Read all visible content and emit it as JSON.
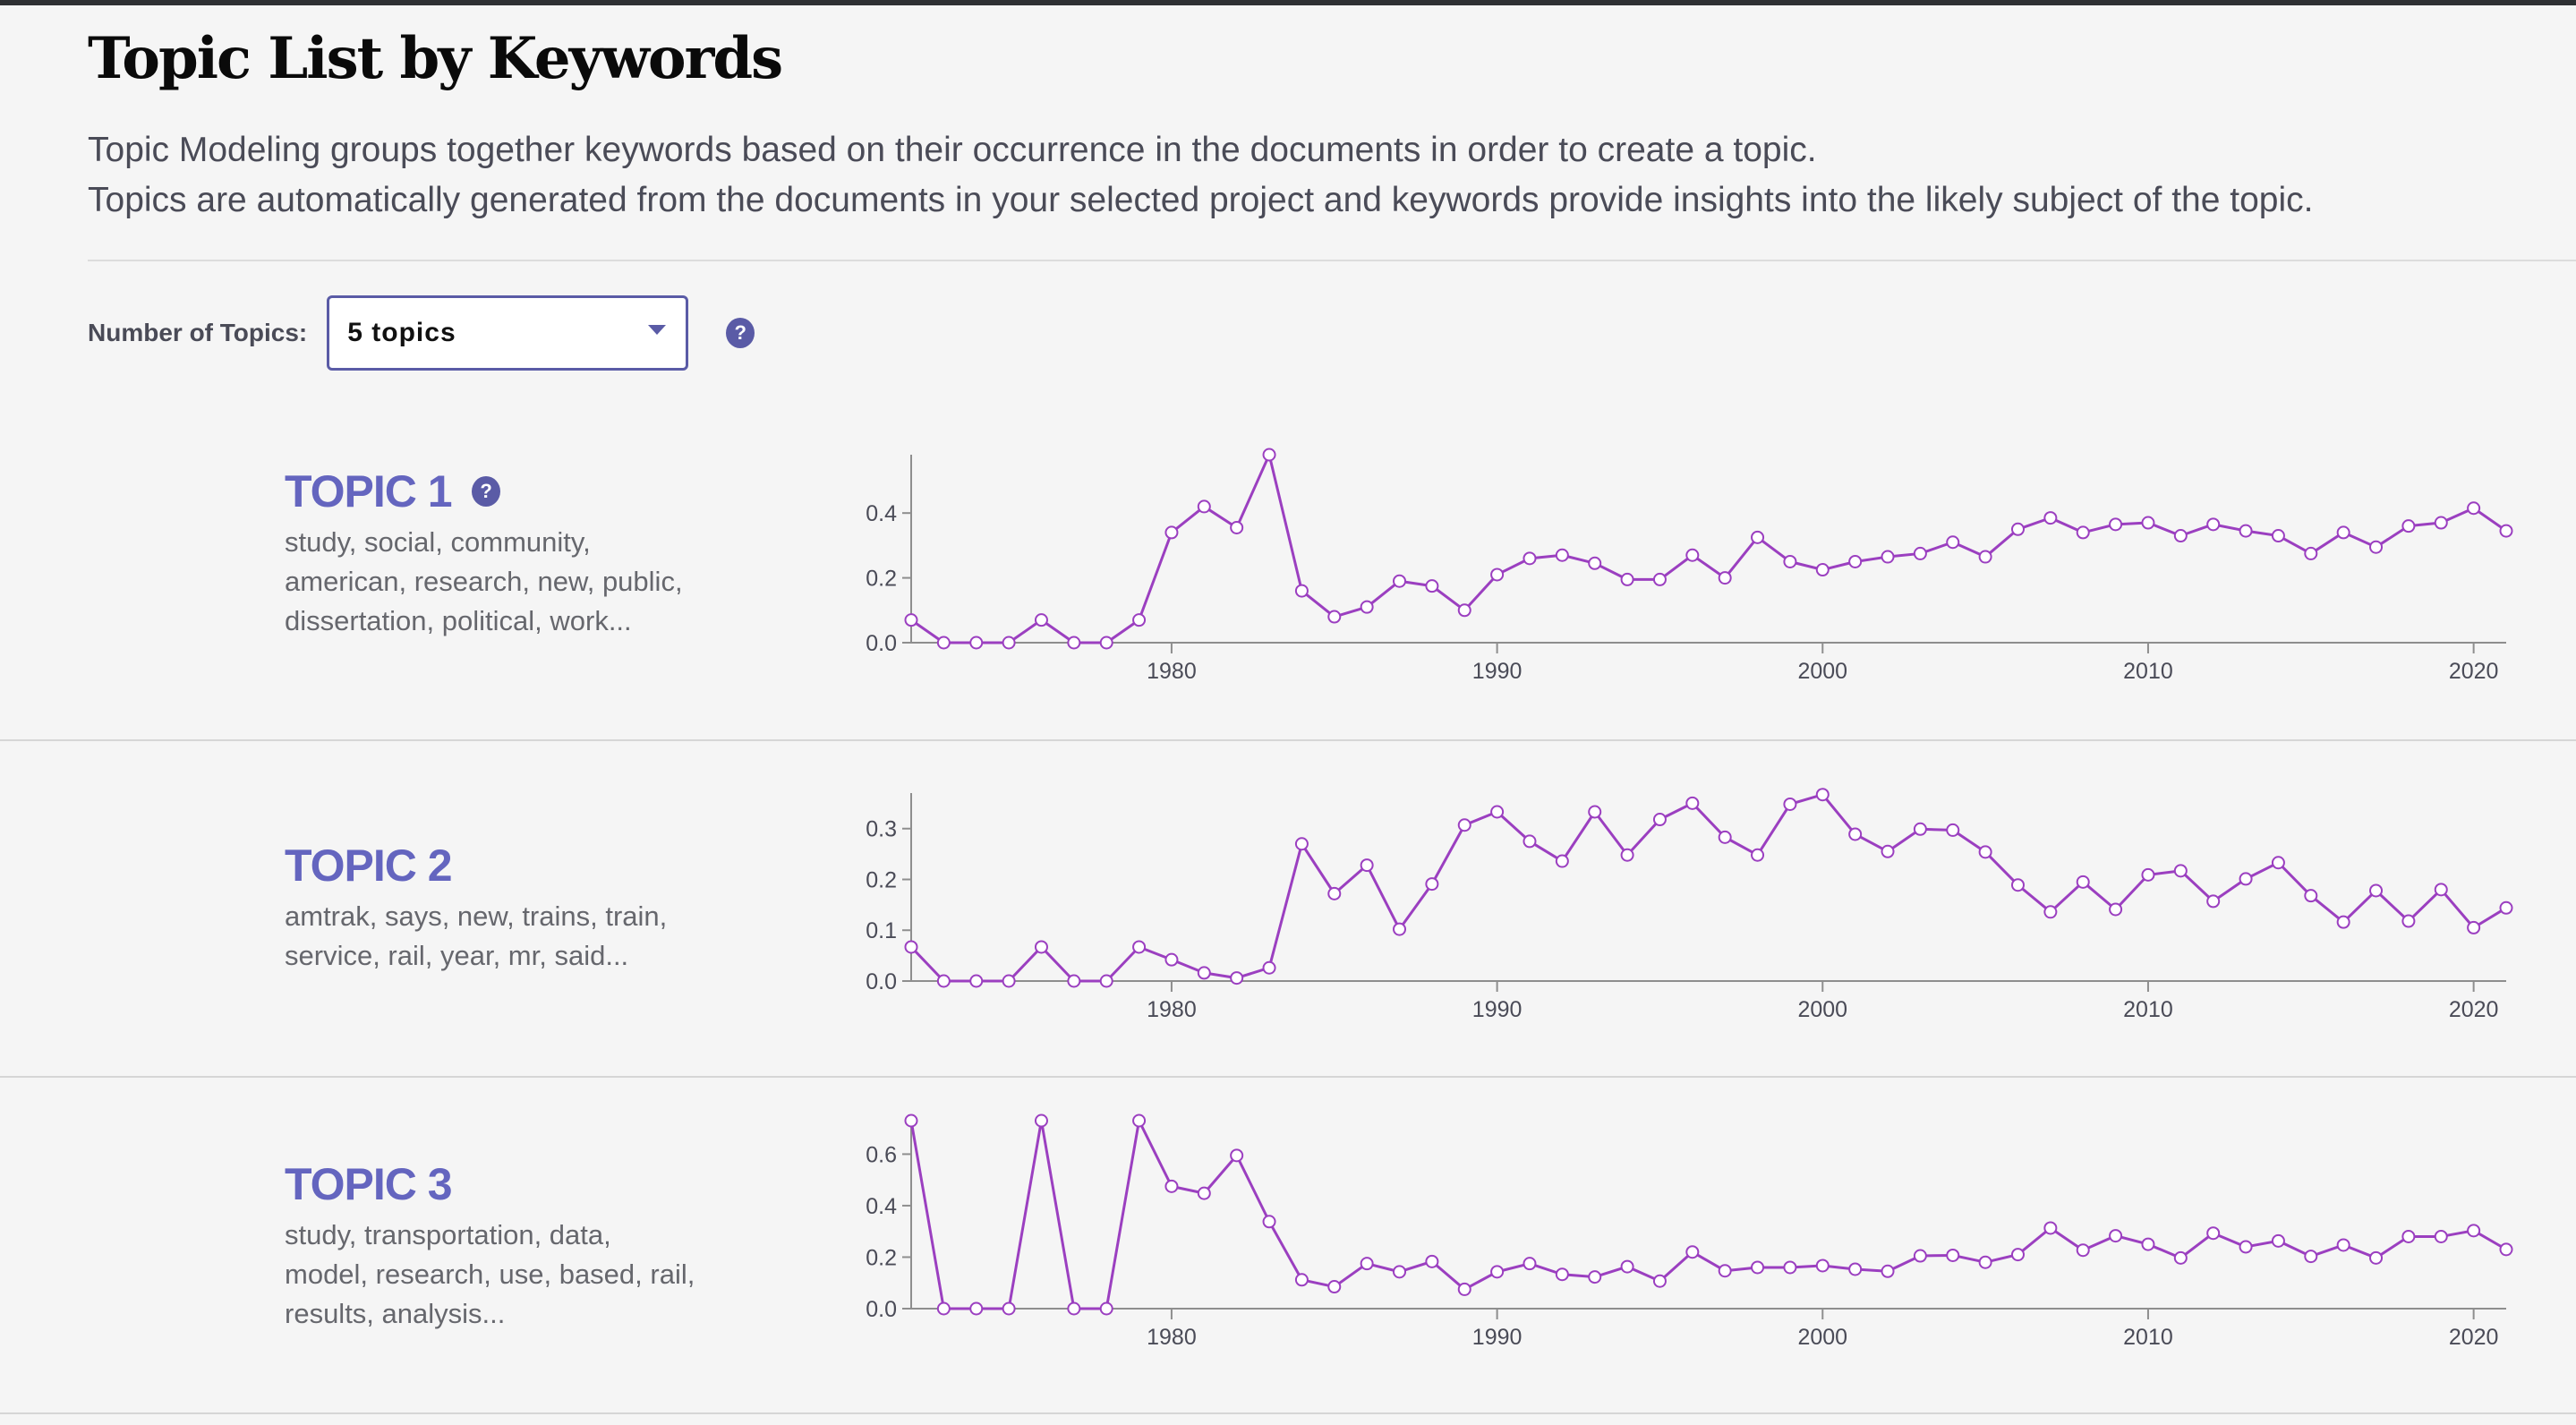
{
  "page": {
    "title": "Topic List by Keywords",
    "intro_line1": "Topic Modeling groups together keywords based on their occurrence in the documents in order to create a topic.",
    "intro_line2": "Topics are automatically generated from the documents in your selected project and keywords provide insights into the likely subject of the topic."
  },
  "controls": {
    "label": "Number of Topics:",
    "selected": "5 topics",
    "help_glyph": "?"
  },
  "colors": {
    "accent": "#5a5ba6",
    "topic_title": "#6465bf",
    "series": "#9b3fc0"
  },
  "topics": [
    {
      "title": "TOPIC 1",
      "has_help": true,
      "keywords": "study, social, community, american, research, new, public, dissertation, political, work..."
    },
    {
      "title": "TOPIC 2",
      "has_help": false,
      "keywords": "amtrak, says, new, trains, train, service, rail, year, mr, said..."
    },
    {
      "title": "TOPIC 3",
      "has_help": false,
      "keywords": "study, transportation, data, model, research, use, based, rail, results, analysis..."
    }
  ],
  "chart_data": [
    {
      "type": "line",
      "title": "TOPIC 1",
      "xlabel": "",
      "ylabel": "",
      "x_start": 1972,
      "x_end": 2021,
      "xticks": [
        1980,
        1990,
        2000,
        2010,
        2020
      ],
      "yticks": [
        0.0,
        0.2,
        0.4
      ],
      "ylim": [
        0,
        0.58
      ],
      "grid": false,
      "values": [
        0.07,
        0,
        0,
        0,
        0.07,
        0,
        0,
        0.07,
        0.34,
        0.42,
        0.355,
        0.58,
        0.16,
        0.08,
        0.11,
        0.19,
        0.175,
        0.1,
        0.21,
        0.26,
        0.27,
        0.245,
        0.195,
        0.195,
        0.27,
        0.2,
        0.325,
        0.25,
        0.225,
        0.25,
        0.265,
        0.275,
        0.31,
        0.265,
        0.35,
        0.385,
        0.34,
        0.365,
        0.37,
        0.33,
        0.365,
        0.345,
        0.33,
        0.275,
        0.34,
        0.295,
        0.36,
        0.37,
        0.415,
        0.345
      ]
    },
    {
      "type": "line",
      "title": "TOPIC 2",
      "xlabel": "",
      "ylabel": "",
      "x_start": 1972,
      "x_end": 2021,
      "xticks": [
        1980,
        1990,
        2000,
        2010,
        2020
      ],
      "yticks": [
        0.0,
        0.1,
        0.2,
        0.3
      ],
      "ylim": [
        0,
        0.37
      ],
      "grid": false,
      "values": [
        0.067,
        0,
        0,
        0,
        0.067,
        0,
        0,
        0.067,
        0.042,
        0.016,
        0.006,
        0.026,
        0.27,
        0.172,
        0.228,
        0.102,
        0.191,
        0.307,
        0.333,
        0.275,
        0.236,
        0.333,
        0.248,
        0.318,
        0.35,
        0.283,
        0.248,
        0.348,
        0.367,
        0.289,
        0.255,
        0.299,
        0.297,
        0.254,
        0.189,
        0.136,
        0.195,
        0.141,
        0.209,
        0.217,
        0.157,
        0.201,
        0.233,
        0.168,
        0.116,
        0.178,
        0.118,
        0.18,
        0.105,
        0.144
      ]
    },
    {
      "type": "line",
      "title": "TOPIC 3",
      "xlabel": "",
      "ylabel": "",
      "x_start": 1972,
      "x_end": 2021,
      "xticks": [
        1980,
        1990,
        2000,
        2010,
        2020
      ],
      "yticks": [
        0.0,
        0.2,
        0.4,
        0.6
      ],
      "ylim": [
        0,
        0.73
      ],
      "grid": false,
      "values": [
        0.73,
        0,
        0,
        0,
        0.73,
        0,
        0,
        0.73,
        0.475,
        0.448,
        0.595,
        0.338,
        0.112,
        0.085,
        0.175,
        0.143,
        0.183,
        0.075,
        0.143,
        0.175,
        0.133,
        0.123,
        0.163,
        0.107,
        0.22,
        0.147,
        0.16,
        0.16,
        0.167,
        0.153,
        0.145,
        0.205,
        0.207,
        0.18,
        0.21,
        0.313,
        0.227,
        0.283,
        0.25,
        0.197,
        0.293,
        0.24,
        0.263,
        0.203,
        0.247,
        0.197,
        0.28,
        0.28,
        0.303,
        0.23
      ]
    }
  ]
}
